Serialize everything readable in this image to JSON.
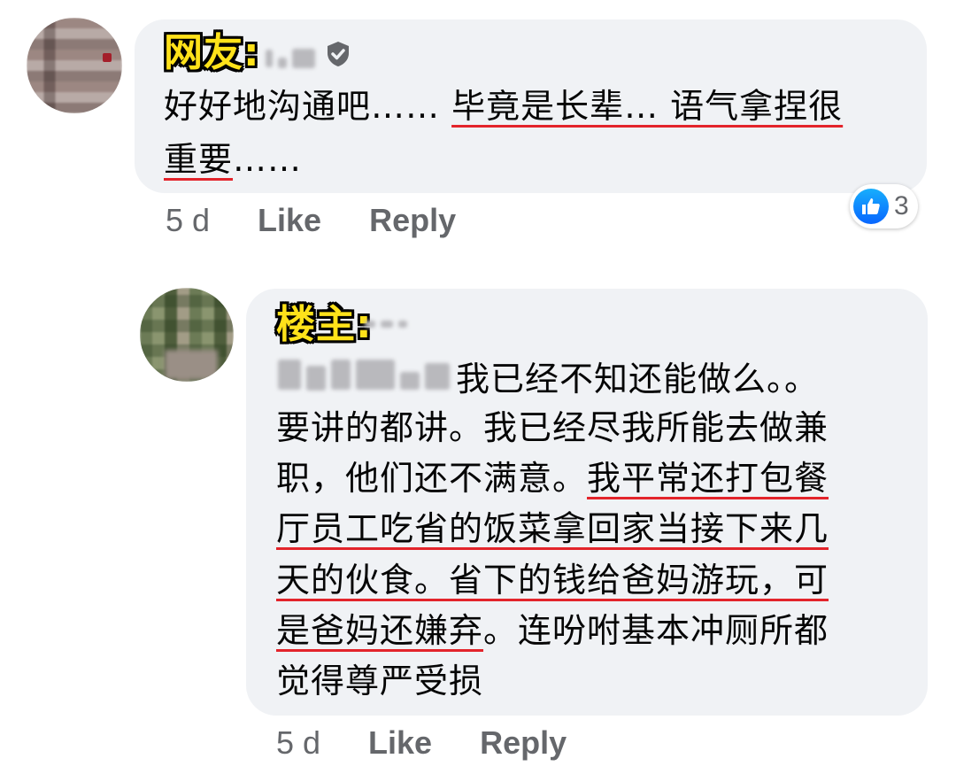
{
  "comment1": {
    "tag": "网友:",
    "text_line1_plain": "好好地沟通吧…… ",
    "text_line1_underlined": "毕竟是长辈… 语气拿捏很",
    "text_line2_underlined": "重要",
    "text_line2_plain": "……",
    "time": "5 d",
    "like_label": "Like",
    "reply_label": "Reply",
    "reaction_count": "3",
    "reaction_icon": "thumbs-up-icon",
    "verified_icon": "shield-check-icon"
  },
  "comment2": {
    "tag": "楼主:",
    "line1": "我已经不知还能做么。。",
    "line2": "要讲的都讲。我已经尽我所能去做兼",
    "line3_plain": "职，他们还不满意。",
    "line3_underlined": "我平常还打包餐",
    "line4_underlined": "厅员工吃省的饭菜拿回家当接下来几",
    "line5_underlined": "天的伙食。省下的钱给爸妈游玩，可",
    "line6_underlined": "是爸妈还嫌弃",
    "line6_plain": "。连吩咐基本冲厕所都",
    "line7": "觉得尊严受损",
    "time": "5 d",
    "like_label": "Like",
    "reply_label": "Reply"
  },
  "colors": {
    "bubble": "#f0f2f5",
    "meta_text": "#65676b",
    "underline": "#e3242b",
    "tag_fill": "#ffe21a",
    "like_blue": "#0866ff"
  }
}
